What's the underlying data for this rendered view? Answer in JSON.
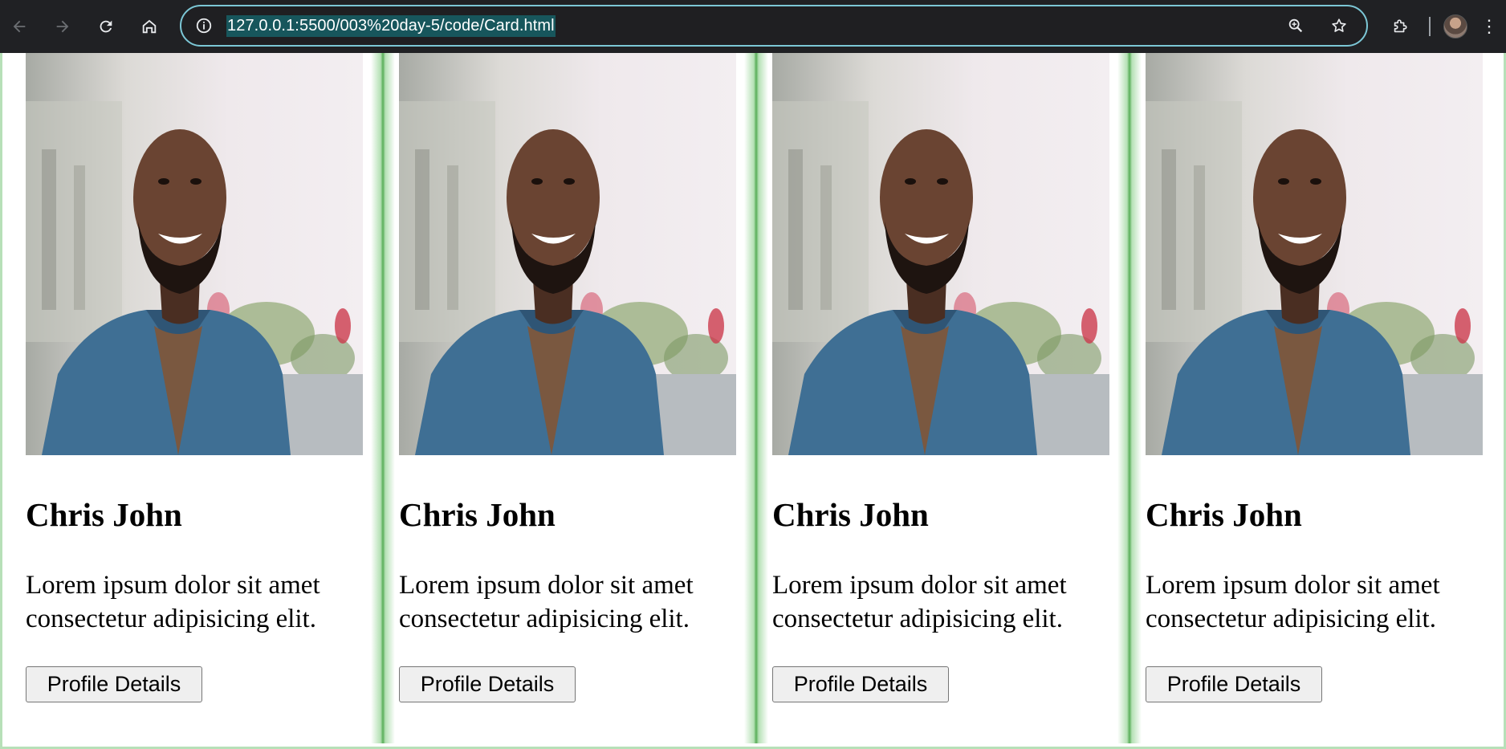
{
  "browser": {
    "url": "127.0.0.1:5500/003%20day-5/code/Card.html",
    "icons": {
      "back": "arrow-left-icon",
      "forward": "arrow-right-icon",
      "reload": "reload-icon",
      "home": "home-icon",
      "site_info": "info-icon",
      "zoom": "zoom-icon",
      "bookmark": "star-icon",
      "extensions": "puzzle-icon",
      "menu": "more-vert-icon"
    }
  },
  "cards": [
    {
      "name": "Chris John",
      "description": "Lorem ipsum dolor sit amet consectetur adipisicing elit.",
      "button_label": "Profile Details"
    },
    {
      "name": "Chris John",
      "description": "Lorem ipsum dolor sit amet consectetur adipisicing elit.",
      "button_label": "Profile Details"
    },
    {
      "name": "Chris John",
      "description": "Lorem ipsum dolor sit amet consectetur adipisicing elit.",
      "button_label": "Profile Details"
    },
    {
      "name": "Chris John",
      "description": "Lorem ipsum dolor sit amet consectetur adipisicing elit.",
      "button_label": "Profile Details"
    }
  ],
  "colors": {
    "toolbar_bg": "#202124",
    "omnibox_border": "#7cc7d6",
    "url_highlight": "#17565c",
    "card_shadow": "#3ca03c"
  }
}
